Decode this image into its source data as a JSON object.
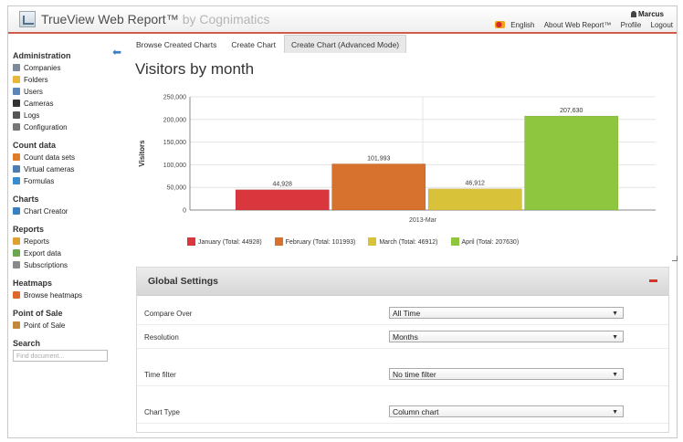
{
  "header": {
    "brand": "TrueView Web Report™",
    "brand_suffix": "by Cognimatics",
    "user": "Marcus",
    "links": [
      "English",
      "About Web Report™",
      "Profile",
      "Logout"
    ]
  },
  "tabs": [
    {
      "label": "Browse Created Charts",
      "active": false
    },
    {
      "label": "Create Chart",
      "active": false
    },
    {
      "label": "Create Chart (Advanced Mode)",
      "active": true
    }
  ],
  "sidebar": {
    "sections": [
      {
        "title": "Administration",
        "items": [
          {
            "label": "Companies",
            "icon": "building-icon",
            "color": "#7c8a99"
          },
          {
            "label": "Folders",
            "icon": "folder-icon",
            "color": "#e8b63a"
          },
          {
            "label": "Users",
            "icon": "users-icon",
            "color": "#5b86b5"
          },
          {
            "label": "Cameras",
            "icon": "camera-icon",
            "color": "#333333"
          },
          {
            "label": "Logs",
            "icon": "log-icon",
            "color": "#555555"
          },
          {
            "label": "Configuration",
            "icon": "config-icon",
            "color": "#777777"
          }
        ]
      },
      {
        "title": "Count data",
        "items": [
          {
            "label": "Count data sets",
            "icon": "dataset-icon",
            "color": "#e07b2a"
          },
          {
            "label": "Virtual cameras",
            "icon": "virtual-camera-icon",
            "color": "#4a7fb3"
          },
          {
            "label": "Formulas",
            "icon": "formula-icon",
            "color": "#3c8bcf"
          }
        ]
      },
      {
        "title": "Charts",
        "items": [
          {
            "label": "Chart Creator",
            "icon": "chart-icon",
            "color": "#3a7fc4"
          }
        ]
      },
      {
        "title": "Reports",
        "items": [
          {
            "label": "Reports",
            "icon": "report-icon",
            "color": "#e0a030"
          },
          {
            "label": "Export data",
            "icon": "export-icon",
            "color": "#6aa84f"
          },
          {
            "label": "Subscriptions",
            "icon": "subscription-icon",
            "color": "#8a8a8a"
          }
        ]
      },
      {
        "title": "Heatmaps",
        "items": [
          {
            "label": "Browse heatmaps",
            "icon": "heatmap-icon",
            "color": "#e0672a"
          }
        ]
      },
      {
        "title": "Point of Sale",
        "items": [
          {
            "label": "Point of Sale",
            "icon": "pos-icon",
            "color": "#c08a3a"
          }
        ]
      },
      {
        "title": "Search",
        "items": []
      }
    ],
    "search_placeholder": "Find document..."
  },
  "page": {
    "title": "Visitors by month"
  },
  "chart_data": {
    "type": "bar",
    "categories": [
      "2013-Mar"
    ],
    "series": [
      {
        "name": "January (Total: 44928)",
        "values": [
          44928
        ],
        "label": "44,928",
        "color": "#d9363e"
      },
      {
        "name": "February (Total: 101993)",
        "values": [
          101993
        ],
        "label": "101,993",
        "color": "#d6712e"
      },
      {
        "name": "March (Total: 46912)",
        "values": [
          46912
        ],
        "label": "46,912",
        "color": "#d8c23a"
      },
      {
        "name": "April (Total: 207630)",
        "values": [
          207630
        ],
        "label": "207,630",
        "color": "#8ec63f"
      }
    ],
    "ylabel": "Visitors",
    "ylim": [
      0,
      250000
    ],
    "yticks": [
      "0",
      "50,000",
      "100,000",
      "150,000",
      "200,000",
      "250,000"
    ],
    "grid": true,
    "legend": "bottom"
  },
  "settings": {
    "title": "Global Settings",
    "rows": [
      {
        "label": "Compare Over",
        "value": "All Time"
      },
      {
        "label": "Resolution",
        "value": "Months"
      },
      {
        "label": "Time filter",
        "value": "No time filter"
      },
      {
        "label": "Chart Type",
        "value": "Column chart"
      }
    ]
  }
}
